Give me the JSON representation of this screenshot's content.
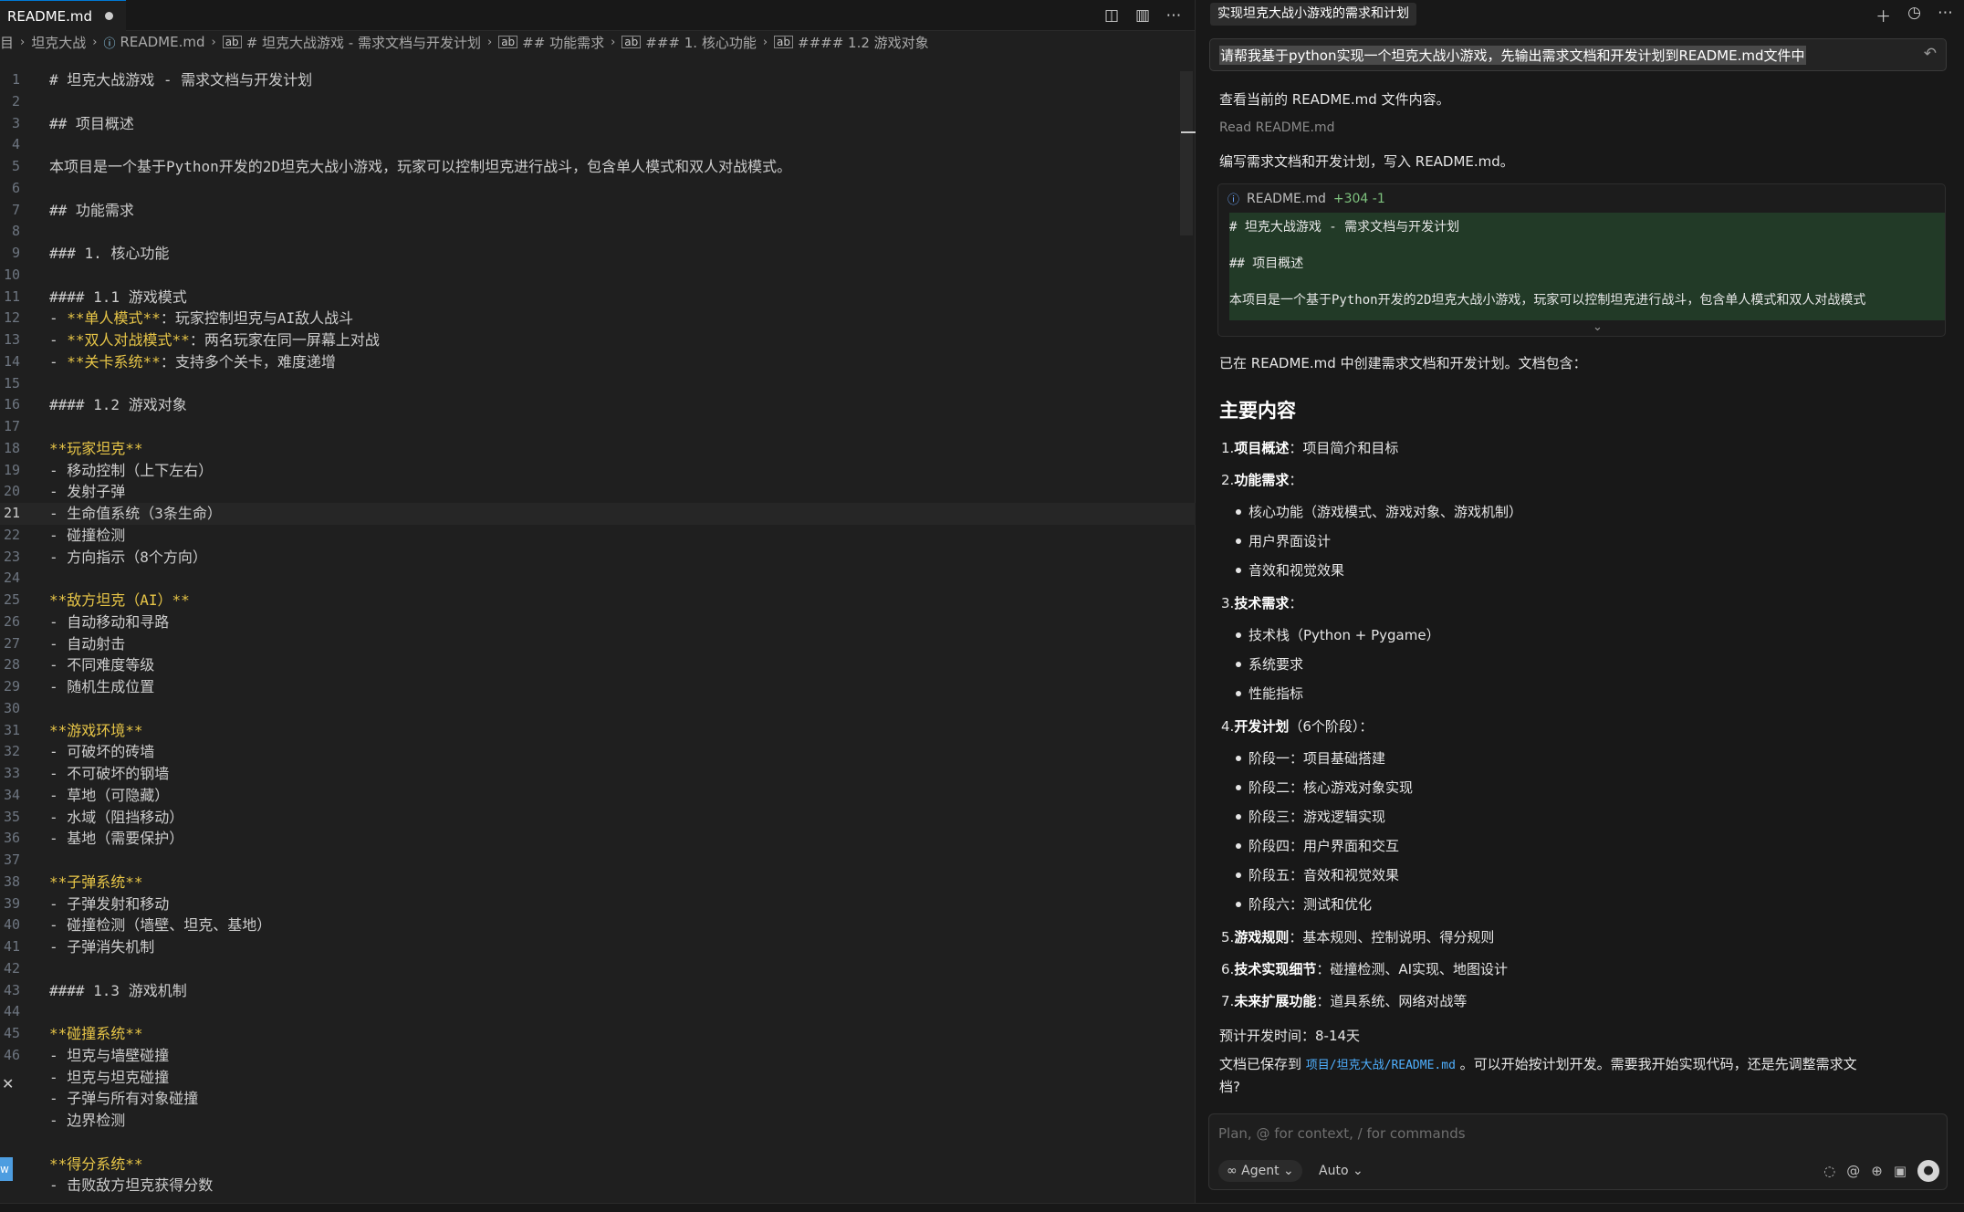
{
  "editor": {
    "tab_label": "README.md",
    "breadcrumb": [
      "目",
      "坦克大战",
      "README.md",
      "# 坦克大战游戏 - 需求文档与开发计划",
      "## 功能需求",
      "### 1. 核心功能",
      "#### 1.2 游戏对象"
    ],
    "active_line": 21,
    "lines": [
      {
        "n": "1",
        "t": "# 坦克大战游戏 - 需求文档与开发计划"
      },
      {
        "n": "2",
        "t": ""
      },
      {
        "n": "3",
        "t": "## 项目概述"
      },
      {
        "n": "4",
        "t": ""
      },
      {
        "n": "5",
        "t": "本项目是一个基于Python开发的2D坦克大战小游戏，玩家可以控制坦克进行战斗，包含单人模式和双人对战模式。"
      },
      {
        "n": "6",
        "t": ""
      },
      {
        "n": "7",
        "t": "## 功能需求"
      },
      {
        "n": "8",
        "t": ""
      },
      {
        "n": "9",
        "t": "### 1. 核心功能"
      },
      {
        "n": "10",
        "t": ""
      },
      {
        "n": "11",
        "t": "#### 1.1 游戏模式"
      },
      {
        "n": "12",
        "p": "- ",
        "b": "**单人模式**",
        "t": "：玩家控制坦克与AI敌人战斗"
      },
      {
        "n": "13",
        "p": "- ",
        "b": "**双人对战模式**",
        "t": "：两名玩家在同一屏幕上对战"
      },
      {
        "n": "14",
        "p": "- ",
        "b": "**关卡系统**",
        "t": "：支持多个关卡，难度递增"
      },
      {
        "n": "15",
        "t": ""
      },
      {
        "n": "16",
        "t": "#### 1.2 游戏对象"
      },
      {
        "n": "17",
        "t": ""
      },
      {
        "n": "18",
        "b": "**玩家坦克**"
      },
      {
        "n": "19",
        "t": "- 移动控制（上下左右）"
      },
      {
        "n": "20",
        "t": "- 发射子弹"
      },
      {
        "n": "21",
        "t": "- 生命值系统（3条生命）"
      },
      {
        "n": "22",
        "t": "- 碰撞检测"
      },
      {
        "n": "23",
        "t": "- 方向指示（8个方向）"
      },
      {
        "n": "24",
        "t": ""
      },
      {
        "n": "25",
        "b": "**敌方坦克（AI）**"
      },
      {
        "n": "26",
        "t": "- 自动移动和寻路"
      },
      {
        "n": "27",
        "t": "- 自动射击"
      },
      {
        "n": "28",
        "t": "- 不同难度等级"
      },
      {
        "n": "29",
        "t": "- 随机生成位置"
      },
      {
        "n": "30",
        "t": ""
      },
      {
        "n": "31",
        "b": "**游戏环境**"
      },
      {
        "n": "32",
        "t": "- 可破坏的砖墙"
      },
      {
        "n": "33",
        "t": "- 不可破坏的钢墙"
      },
      {
        "n": "34",
        "t": "- 草地（可隐藏）"
      },
      {
        "n": "35",
        "t": "- 水域（阻挡移动）"
      },
      {
        "n": "36",
        "t": "- 基地（需要保护）"
      },
      {
        "n": "37",
        "t": ""
      },
      {
        "n": "38",
        "b": "**子弹系统**"
      },
      {
        "n": "39",
        "t": "- 子弹发射和移动"
      },
      {
        "n": "40",
        "t": "- 碰撞检测（墙壁、坦克、基地）"
      },
      {
        "n": "41",
        "t": "- 子弹消失机制"
      },
      {
        "n": "42",
        "t": ""
      },
      {
        "n": "43",
        "t": "#### 1.3 游戏机制"
      },
      {
        "n": "44",
        "t": ""
      },
      {
        "n": "45",
        "b": "**碰撞系统**"
      },
      {
        "n": "46",
        "t": "- 坦克与墙壁碰撞"
      },
      {
        "n": "",
        "t": "- 坦克与坦克碰撞"
      },
      {
        "n": "",
        "t": "- 子弹与所有对象碰撞"
      },
      {
        "n": "",
        "t": "- 边界检测"
      },
      {
        "n": "",
        "t": ""
      },
      {
        "n": "",
        "b": "**得分系统**"
      },
      {
        "n": "",
        "t": "- 击败敌方坦克获得分数"
      }
    ]
  },
  "chat": {
    "tab_title": "实现坦克大战小游戏的需求和计划",
    "prompt": "请帮我基于python实现一个坦克大战小游戏，先输出需求文档和开发计划到README.md文件中",
    "msg1": "查看当前的 README.md 文件内容。",
    "read_label": "Read",
    "read_file": "README.md",
    "msg2": "编写需求文档和开发计划，写入 README.md。",
    "diff": {
      "file": "README.md",
      "stat": "+304 -1",
      "lines": [
        "# 坦克大战游戏 - 需求文档与开发计划",
        "## 项目概述",
        "本项目是一个基于Python开发的2D坦克大战小游戏，玩家可以控制坦克进行战斗，包含单人模式和双人对战模式"
      ]
    },
    "summary": "已在 README.md 中创建需求文档和开发计划。文档包含：",
    "heading": "主要内容",
    "items": [
      {
        "num": "1.",
        "title": "项目概述",
        "rest": "：项目简介和目标",
        "sub": []
      },
      {
        "num": "2.",
        "title": "功能需求",
        "rest": "：",
        "sub": [
          "核心功能（游戏模式、游戏对象、游戏机制）",
          "用户界面设计",
          "音效和视觉效果"
        ]
      },
      {
        "num": "3.",
        "title": "技术需求",
        "rest": "：",
        "sub": [
          "技术栈（Python + Pygame）",
          "系统要求",
          "性能指标"
        ]
      },
      {
        "num": "4.",
        "title": "开发计划",
        "rest": "（6个阶段）：",
        "sub": [
          "阶段一：项目基础搭建",
          "阶段二：核心游戏对象实现",
          "阶段三：游戏逻辑实现",
          "阶段四：用户界面和交互",
          "阶段五：音效和视觉效果",
          "阶段六：测试和优化"
        ]
      },
      {
        "num": "5.",
        "title": "游戏规则",
        "rest": "：基本规则、控制说明、得分规则",
        "sub": []
      },
      {
        "num": "6.",
        "title": "技术实现细节",
        "rest": "：碰撞检测、AI实现、地图设计",
        "sub": []
      },
      {
        "num": "7.",
        "title": "未来扩展功能",
        "rest": "：道具系统、网络对战等",
        "sub": []
      }
    ],
    "estimate": "预计开发时间：8-14天",
    "saved_pre": "文档已保存到",
    "saved_path": "项目/坦克大战/README.md",
    "saved_post": "。可以开始按计划开发。需要我开始实现代码，还是先调整需求文",
    "saved_post2": "档?",
    "input_placeholder": "Plan, @ for context, / for commands",
    "agent_label": "Agent",
    "auto_label": "Auto"
  }
}
